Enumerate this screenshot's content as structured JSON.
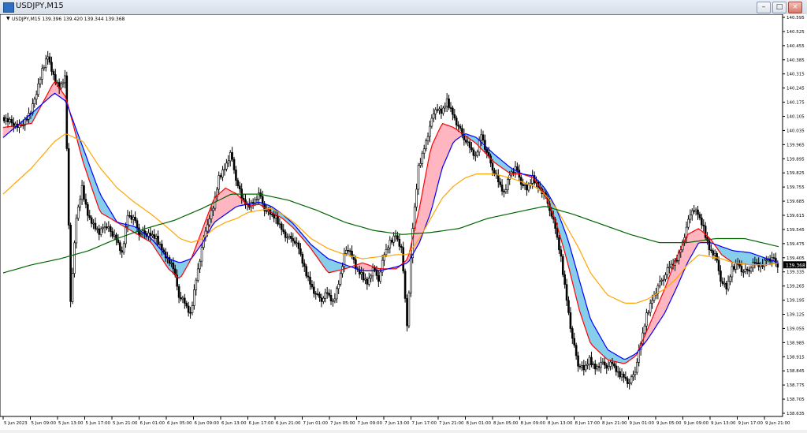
{
  "window": {
    "title": "USDJPY,M15",
    "buttons": [
      "–",
      "□",
      "×"
    ]
  },
  "chart_info": {
    "symbol_line": "USDJPY,M15  139.396 139.420 139.344 139.368",
    "current_price_label": "139.368"
  },
  "colors": {
    "candles": "#000000",
    "bull_cloud": "#ffb6c1",
    "bear_cloud": "#87ceeb",
    "fast_line": "#ff0000",
    "slow_line": "#0000ff",
    "orange_ma": "#ffa500",
    "green_ma": "#006400",
    "price_tag": "#000000"
  },
  "chart_data": {
    "type": "line",
    "title": "USDJPY,M15",
    "ylim": [
      138.635,
      140.595
    ],
    "y_ticks": [
      "140.595",
      "140.525",
      "140.455",
      "140.385",
      "140.315",
      "140.245",
      "140.175",
      "140.105",
      "140.035",
      "139.965",
      "139.895",
      "139.825",
      "139.755",
      "139.685",
      "139.615",
      "139.545",
      "139.475",
      "139.405",
      "139.335",
      "139.265",
      "139.195",
      "139.125",
      "139.055",
      "138.985",
      "138.915",
      "138.845",
      "138.775",
      "138.705",
      "138.635"
    ],
    "x_ticks": [
      "5 Jun 2023",
      "5 Jun 09:00",
      "5 Jun 13:00",
      "5 Jun 17:00",
      "5 Jun 21:00",
      "6 Jun 01:00",
      "6 Jun 05:00",
      "6 Jun 09:00",
      "6 Jun 13:00",
      "6 Jun 17:00",
      "6 Jun 21:00",
      "7 Jun 01:00",
      "7 Jun 05:00",
      "7 Jun 09:00",
      "7 Jun 13:00",
      "7 Jun 17:00",
      "7 Jun 21:00",
      "8 Jun 01:00",
      "8 Jun 05:00",
      "8 Jun 09:00",
      "8 Jun 13:00",
      "8 Jun 17:00",
      "8 Jun 21:00",
      "9 Jun 01:00",
      "9 Jun 05:00",
      "9 Jun 09:00",
      "9 Jun 13:00",
      "9 Jun 17:00",
      "9 Jun 21:00"
    ],
    "price_path": [
      [
        0,
        140.1
      ],
      [
        3,
        140.05
      ],
      [
        5,
        140.12
      ],
      [
        7,
        140.33
      ],
      [
        8,
        140.4
      ],
      [
        9,
        140.3
      ],
      [
        10,
        140.25
      ],
      [
        11,
        140.3
      ],
      [
        12,
        139.2
      ],
      [
        13,
        139.6
      ],
      [
        14,
        139.75
      ],
      [
        15,
        139.62
      ],
      [
        17,
        139.52
      ],
      [
        18,
        139.57
      ],
      [
        20,
        139.5
      ],
      [
        21,
        139.42
      ],
      [
        22,
        139.62
      ],
      [
        23,
        139.6
      ],
      [
        24,
        139.53
      ],
      [
        26,
        139.52
      ],
      [
        27,
        139.5
      ],
      [
        28,
        139.45
      ],
      [
        30,
        139.35
      ],
      [
        31,
        139.22
      ],
      [
        32,
        139.18
      ],
      [
        33,
        139.12
      ],
      [
        34,
        139.3
      ],
      [
        35,
        139.45
      ],
      [
        36,
        139.58
      ],
      [
        37,
        139.65
      ],
      [
        38,
        139.8
      ],
      [
        39,
        139.85
      ],
      [
        40,
        139.92
      ],
      [
        41,
        139.8
      ],
      [
        42,
        139.7
      ],
      [
        43,
        139.66
      ],
      [
        44,
        139.68
      ],
      [
        45,
        139.72
      ],
      [
        46,
        139.65
      ],
      [
        47,
        139.62
      ],
      [
        48,
        139.6
      ],
      [
        49,
        139.55
      ],
      [
        50,
        139.5
      ],
      [
        51,
        139.5
      ],
      [
        52,
        139.45
      ],
      [
        53,
        139.35
      ],
      [
        54,
        139.28
      ],
      [
        55,
        139.22
      ],
      [
        56,
        139.2
      ],
      [
        57,
        139.23
      ],
      [
        58,
        139.18
      ],
      [
        59,
        139.28
      ],
      [
        60,
        139.42
      ],
      [
        61,
        139.45
      ],
      [
        62,
        139.35
      ],
      [
        63,
        139.32
      ],
      [
        64,
        139.28
      ],
      [
        65,
        139.35
      ],
      [
        66,
        139.3
      ],
      [
        67,
        139.42
      ],
      [
        68,
        139.48
      ],
      [
        69,
        139.52
      ],
      [
        70,
        139.45
      ],
      [
        71,
        139.08
      ],
      [
        72,
        139.55
      ],
      [
        73,
        139.85
      ],
      [
        74,
        139.95
      ],
      [
        75,
        140.05
      ],
      [
        76,
        140.15
      ],
      [
        77,
        140.12
      ],
      [
        78,
        140.18
      ],
      [
        79,
        140.12
      ],
      [
        80,
        140.05
      ],
      [
        81,
        140.0
      ],
      [
        82,
        139.95
      ],
      [
        83,
        139.9
      ],
      [
        84,
        140.02
      ],
      [
        85,
        139.92
      ],
      [
        86,
        139.85
      ],
      [
        87,
        139.78
      ],
      [
        88,
        139.72
      ],
      [
        89,
        139.82
      ],
      [
        90,
        139.85
      ],
      [
        91,
        139.78
      ],
      [
        92,
        139.74
      ],
      [
        93,
        139.8
      ],
      [
        94,
        139.76
      ],
      [
        95,
        139.72
      ],
      [
        96,
        139.65
      ],
      [
        97,
        139.55
      ],
      [
        98,
        139.4
      ],
      [
        99,
        139.2
      ],
      [
        100,
        139.0
      ],
      [
        101,
        138.88
      ],
      [
        102,
        138.85
      ],
      [
        103,
        138.9
      ],
      [
        104,
        138.86
      ],
      [
        105,
        138.88
      ],
      [
        106,
        138.87
      ],
      [
        107,
        138.88
      ],
      [
        108,
        138.83
      ],
      [
        109,
        138.82
      ],
      [
        110,
        138.78
      ],
      [
        111,
        138.85
      ],
      [
        112,
        138.98
      ],
      [
        113,
        139.12
      ],
      [
        114,
        139.2
      ],
      [
        115,
        139.26
      ],
      [
        116,
        139.31
      ],
      [
        117,
        139.36
      ],
      [
        118,
        139.38
      ],
      [
        119,
        139.45
      ],
      [
        120,
        139.55
      ],
      [
        121,
        139.65
      ],
      [
        122,
        139.62
      ],
      [
        123,
        139.55
      ],
      [
        124,
        139.45
      ],
      [
        125,
        139.42
      ],
      [
        126,
        139.3
      ],
      [
        127,
        139.25
      ],
      [
        128,
        139.35
      ],
      [
        129,
        139.38
      ],
      [
        130,
        139.33
      ],
      [
        131,
        139.35
      ],
      [
        132,
        139.38
      ],
      [
        133,
        139.36
      ],
      [
        134,
        139.4
      ],
      [
        135,
        139.4
      ],
      [
        136,
        139.37
      ]
    ],
    "series": [
      {
        "points": [
          [
            0,
            140.05
          ],
          [
            5,
            140.07
          ],
          [
            9,
            140.28
          ],
          [
            11,
            140.2
          ],
          [
            14,
            139.88
          ],
          [
            17,
            139.63
          ],
          [
            20,
            139.58
          ],
          [
            23,
            139.53
          ],
          [
            26,
            139.48
          ],
          [
            29,
            139.35
          ],
          [
            31,
            139.3
          ],
          [
            33,
            139.4
          ],
          [
            35,
            139.55
          ],
          [
            37,
            139.7
          ],
          [
            39,
            139.75
          ],
          [
            41,
            139.72
          ],
          [
            43,
            139.66
          ],
          [
            45,
            139.67
          ],
          [
            47,
            139.63
          ],
          [
            49,
            139.6
          ],
          [
            51,
            139.55
          ],
          [
            54,
            139.45
          ],
          [
            57,
            139.33
          ],
          [
            60,
            139.35
          ],
          [
            63,
            139.38
          ],
          [
            66,
            139.35
          ],
          [
            69,
            139.35
          ],
          [
            71,
            139.4
          ],
          [
            73,
            139.65
          ],
          [
            75,
            139.95
          ],
          [
            77,
            140.07
          ],
          [
            79,
            140.05
          ],
          [
            81,
            140.01
          ],
          [
            83,
            139.97
          ],
          [
            86,
            139.88
          ],
          [
            89,
            139.82
          ],
          [
            91,
            139.82
          ],
          [
            93,
            139.8
          ],
          [
            95,
            139.72
          ],
          [
            97,
            139.58
          ],
          [
            99,
            139.38
          ],
          [
            101,
            139.15
          ],
          [
            103,
            138.98
          ],
          [
            106,
            138.9
          ],
          [
            109,
            138.88
          ],
          [
            111,
            138.92
          ],
          [
            113,
            139.05
          ],
          [
            116,
            139.25
          ],
          [
            118,
            139.4
          ],
          [
            120,
            139.52
          ],
          [
            122,
            139.55
          ],
          [
            124,
            139.5
          ],
          [
            126,
            139.42
          ],
          [
            128,
            139.38
          ],
          [
            131,
            139.37
          ],
          [
            134,
            139.37
          ],
          [
            136,
            139.38
          ]
        ]
      },
      {
        "points": [
          [
            0,
            140.0
          ],
          [
            5,
            140.12
          ],
          [
            9,
            140.22
          ],
          [
            11,
            140.18
          ],
          [
            14,
            139.95
          ],
          [
            17,
            139.72
          ],
          [
            20,
            139.58
          ],
          [
            23,
            139.56
          ],
          [
            26,
            139.5
          ],
          [
            29,
            139.4
          ],
          [
            31,
            139.38
          ],
          [
            33,
            139.4
          ],
          [
            35,
            139.48
          ],
          [
            37,
            139.58
          ],
          [
            39,
            139.62
          ],
          [
            41,
            139.66
          ],
          [
            43,
            139.67
          ],
          [
            45,
            139.68
          ],
          [
            47,
            139.66
          ],
          [
            49,
            139.62
          ],
          [
            51,
            139.57
          ],
          [
            54,
            139.47
          ],
          [
            57,
            139.4
          ],
          [
            60,
            139.37
          ],
          [
            63,
            139.34
          ],
          [
            66,
            139.34
          ],
          [
            69,
            139.36
          ],
          [
            71,
            139.38
          ],
          [
            73,
            139.48
          ],
          [
            75,
            139.63
          ],
          [
            77,
            139.85
          ],
          [
            79,
            139.98
          ],
          [
            81,
            140.02
          ],
          [
            83,
            140.0
          ],
          [
            86,
            139.92
          ],
          [
            89,
            139.85
          ],
          [
            91,
            139.82
          ],
          [
            93,
            139.81
          ],
          [
            95,
            139.75
          ],
          [
            97,
            139.65
          ],
          [
            99,
            139.5
          ],
          [
            101,
            139.3
          ],
          [
            103,
            139.1
          ],
          [
            106,
            138.95
          ],
          [
            109,
            138.9
          ],
          [
            111,
            138.93
          ],
          [
            113,
            139.0
          ],
          [
            116,
            139.13
          ],
          [
            118,
            139.25
          ],
          [
            120,
            139.38
          ],
          [
            122,
            139.48
          ],
          [
            124,
            139.48
          ],
          [
            126,
            139.46
          ],
          [
            128,
            139.44
          ],
          [
            131,
            139.43
          ],
          [
            134,
            139.4
          ],
          [
            136,
            139.38
          ]
        ]
      },
      {
        "points": [
          [
            0,
            139.72
          ],
          [
            5,
            139.85
          ],
          [
            9,
            139.98
          ],
          [
            11,
            140.02
          ],
          [
            14,
            139.98
          ],
          [
            17,
            139.85
          ],
          [
            20,
            139.75
          ],
          [
            23,
            139.68
          ],
          [
            26,
            139.62
          ],
          [
            29,
            139.55
          ],
          [
            31,
            139.5
          ],
          [
            33,
            139.48
          ],
          [
            35,
            139.5
          ],
          [
            37,
            139.55
          ],
          [
            39,
            139.58
          ],
          [
            41,
            139.6
          ],
          [
            43,
            139.63
          ],
          [
            45,
            139.64
          ],
          [
            47,
            139.65
          ],
          [
            49,
            139.62
          ],
          [
            51,
            139.58
          ],
          [
            54,
            139.5
          ],
          [
            57,
            139.45
          ],
          [
            60,
            139.42
          ],
          [
            63,
            139.4
          ],
          [
            66,
            139.41
          ],
          [
            69,
            139.42
          ],
          [
            71,
            139.42
          ],
          [
            73,
            139.5
          ],
          [
            75,
            139.6
          ],
          [
            77,
            139.7
          ],
          [
            79,
            139.76
          ],
          [
            81,
            139.8
          ],
          [
            83,
            139.82
          ],
          [
            86,
            139.82
          ],
          [
            89,
            139.8
          ],
          [
            91,
            139.78
          ],
          [
            93,
            139.76
          ],
          [
            95,
            139.72
          ],
          [
            97,
            139.65
          ],
          [
            99,
            139.55
          ],
          [
            101,
            139.45
          ],
          [
            103,
            139.33
          ],
          [
            106,
            139.22
          ],
          [
            109,
            139.18
          ],
          [
            111,
            139.18
          ],
          [
            113,
            139.2
          ],
          [
            116,
            139.25
          ],
          [
            118,
            139.3
          ],
          [
            120,
            139.37
          ],
          [
            122,
            139.42
          ],
          [
            124,
            139.41
          ],
          [
            126,
            139.4
          ],
          [
            128,
            139.38
          ],
          [
            131,
            139.37
          ],
          [
            134,
            139.37
          ],
          [
            136,
            139.38
          ]
        ]
      },
      {
        "points": [
          [
            0,
            139.33
          ],
          [
            5,
            139.37
          ],
          [
            10,
            139.4
          ],
          [
            15,
            139.44
          ],
          [
            20,
            139.5
          ],
          [
            25,
            139.55
          ],
          [
            30,
            139.59
          ],
          [
            35,
            139.65
          ],
          [
            40,
            139.72
          ],
          [
            45,
            139.72
          ],
          [
            50,
            139.69
          ],
          [
            55,
            139.64
          ],
          [
            60,
            139.58
          ],
          [
            65,
            139.54
          ],
          [
            70,
            139.52
          ],
          [
            75,
            139.53
          ],
          [
            80,
            139.55
          ],
          [
            85,
            139.6
          ],
          [
            90,
            139.63
          ],
          [
            95,
            139.66
          ],
          [
            100,
            139.62
          ],
          [
            105,
            139.57
          ],
          [
            110,
            139.52
          ],
          [
            115,
            139.48
          ],
          [
            120,
            139.48
          ],
          [
            125,
            139.5
          ],
          [
            130,
            139.5
          ],
          [
            136,
            139.46
          ]
        ]
      }
    ]
  }
}
